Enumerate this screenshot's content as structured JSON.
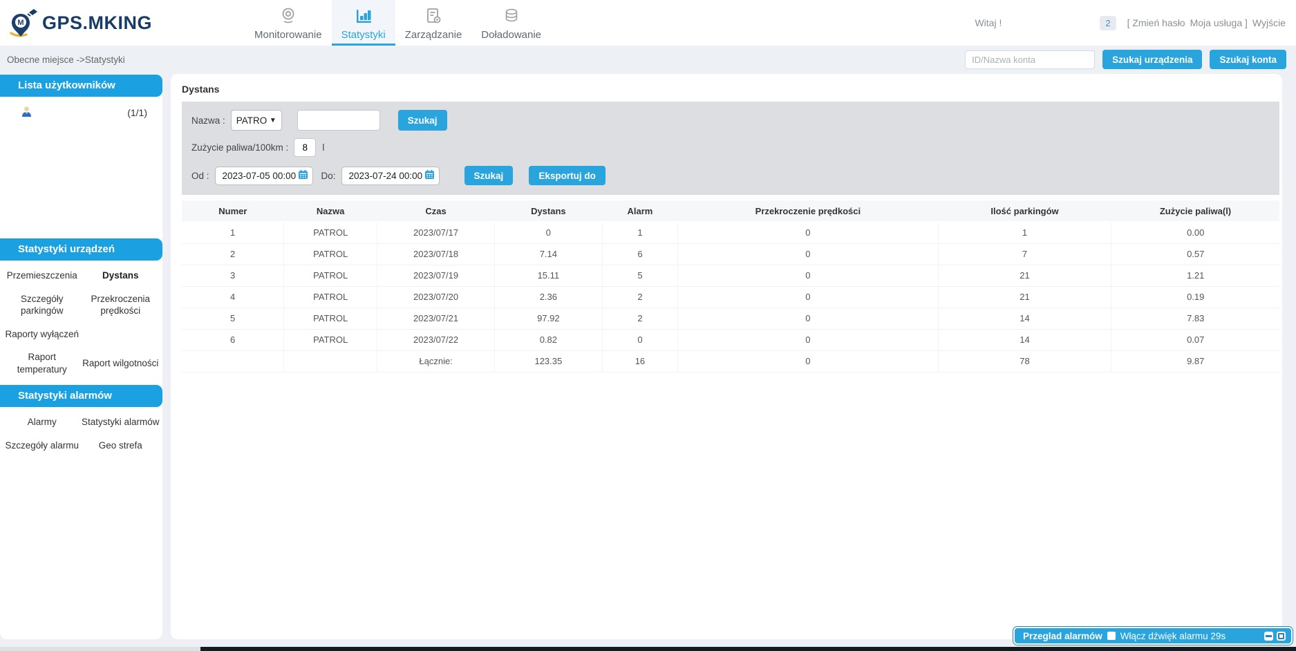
{
  "header": {
    "logo_text": "GPS.MKING",
    "tabs": [
      {
        "label": "Monitorowanie",
        "icon": "webcam-icon",
        "active": false
      },
      {
        "label": "Statystyki",
        "icon": "bar-chart-icon",
        "active": true
      },
      {
        "label": "Zarządzanie",
        "icon": "document-gear-icon",
        "active": false
      },
      {
        "label": "Doładowanie",
        "icon": "coins-icon",
        "active": false
      }
    ],
    "welcome": "Witaj !",
    "badge_count": "2",
    "links": [
      "[ Zmień hasło",
      "Moja usługa ]",
      "Wyjście"
    ]
  },
  "breadcrumb": {
    "text": "Obecne miejsce ->Statystyki",
    "search_placeholder": "ID/Nazwa konta",
    "search_device_button": "Szukaj urządzenia",
    "search_account_button": "Szukaj konta"
  },
  "sidebar": {
    "users_header": "Lista użytkowników",
    "user_icon": "user-avatar-icon",
    "user_count": "(1/1)",
    "device_stats_header": "Statystyki urządzeń",
    "device_items": [
      "Przemieszczenia",
      "Dystans",
      "Szczegóły parkingów",
      "Przekroczenia prędkości",
      "Raporty wyłączeń",
      "Raport temperatury",
      "Raport wilgotności"
    ],
    "active_item": "Dystans",
    "alarm_stats_header": "Statystyki alarmów",
    "alarm_items": [
      "Alarmy",
      "Statystyki alarmów",
      "Szczegóły alarmu",
      "Geo strefa"
    ]
  },
  "main": {
    "panel_title": "Dystans",
    "filters": {
      "name_label": "Nazwa :",
      "name_select_value": "PATRO",
      "search_button": "Szukaj",
      "fuel_label": "Zużycie paliwa/100km :",
      "fuel_value": "8",
      "fuel_unit": "l",
      "from_label": "Od :",
      "from_value": "2023-07-05 00:00",
      "to_label": "Do:",
      "to_value": "2023-07-24 00:00",
      "search_button2": "Szukaj",
      "export_button": "Eksportuj do"
    },
    "table": {
      "columns": [
        "Numer",
        "Nazwa",
        "Czas",
        "Dystans",
        "Alarm",
        "Przekroczenie prędkości",
        "Ilość parkingów",
        "Zużycie paliwa(l)"
      ],
      "rows": [
        [
          "1",
          "PATROL",
          "2023/07/17",
          "0",
          "1",
          "0",
          "1",
          "0.00"
        ],
        [
          "2",
          "PATROL",
          "2023/07/18",
          "7.14",
          "6",
          "0",
          "7",
          "0.57"
        ],
        [
          "3",
          "PATROL",
          "2023/07/19",
          "15.11",
          "5",
          "0",
          "21",
          "1.21"
        ],
        [
          "4",
          "PATROL",
          "2023/07/20",
          "2.36",
          "2",
          "0",
          "21",
          "0.19"
        ],
        [
          "5",
          "PATROL",
          "2023/07/21",
          "97.92",
          "2",
          "0",
          "14",
          "7.83"
        ],
        [
          "6",
          "PATROL",
          "2023/07/22",
          "0.82",
          "0",
          "0",
          "14",
          "0.07"
        ]
      ],
      "total_row": [
        "",
        "",
        "Łącznie:",
        "123.35",
        "16",
        "0",
        "78",
        "9.87"
      ]
    }
  },
  "alarm_bar": {
    "title": "Przeglad alarmów",
    "checkbox_label": "Włącz dźwięk alarmu 29s",
    "icons": [
      "minimize-icon",
      "restore-window-icon"
    ]
  },
  "colors": {
    "accent": "#29a4dc",
    "sidebar_header_blue": "#1ba1e2",
    "logo_navy": "#173c66",
    "filter_bg": "#dcdee1"
  }
}
